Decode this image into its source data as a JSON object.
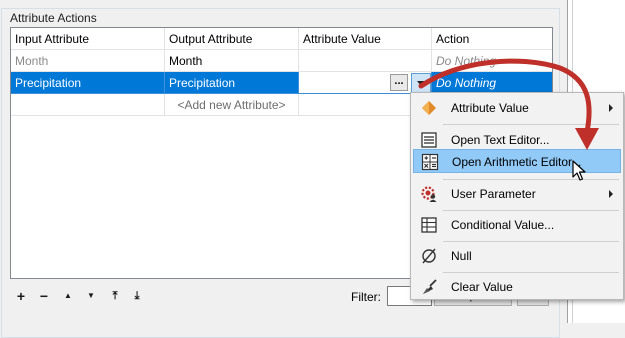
{
  "group": {
    "title": "Attribute Actions"
  },
  "table": {
    "headers": [
      "Input Attribute",
      "Output Attribute",
      "Attribute Value",
      "Action"
    ],
    "rows": [
      {
        "input": "Month",
        "output": "Month",
        "value": "",
        "action": "Do Nothing"
      },
      {
        "input": "Precipitation",
        "output": "Precipitation",
        "value": "",
        "action": "Do Nothing"
      }
    ],
    "new_row_placeholder": "<Add new Attribute>",
    "ellipsis_button": "...",
    "selected_row": 1
  },
  "toolbar": {
    "add": "+",
    "remove": "−",
    "move_up": "▲",
    "move_down": "▼",
    "move_top": "⤒",
    "move_bottom": "⤓"
  },
  "filter": {
    "label": "Filter:",
    "value": ""
  },
  "buttons": {
    "import": "Import"
  },
  "menu": {
    "items": [
      {
        "label": "Attribute Value",
        "icon": "diamond-arrow-icon",
        "submenu": true
      },
      {
        "label": "Open Text Editor...",
        "icon": "text-editor-icon",
        "submenu": false
      },
      {
        "label": "Open Arithmetic Editor...",
        "icon": "calculator-icon",
        "submenu": false,
        "highlighted": true
      },
      {
        "label": "User Parameter",
        "icon": "user-parameter-icon",
        "submenu": true
      },
      {
        "label": "Conditional Value...",
        "icon": "table-grid-icon",
        "submenu": false
      },
      {
        "label": "Null",
        "icon": "null-icon",
        "submenu": false
      },
      {
        "label": "Clear Value",
        "icon": "broom-icon",
        "submenu": false
      }
    ]
  },
  "colors": {
    "selection": "#0078d7",
    "menu_highlight": "#91c9f7",
    "annotation_arrow": "#c0302a"
  }
}
